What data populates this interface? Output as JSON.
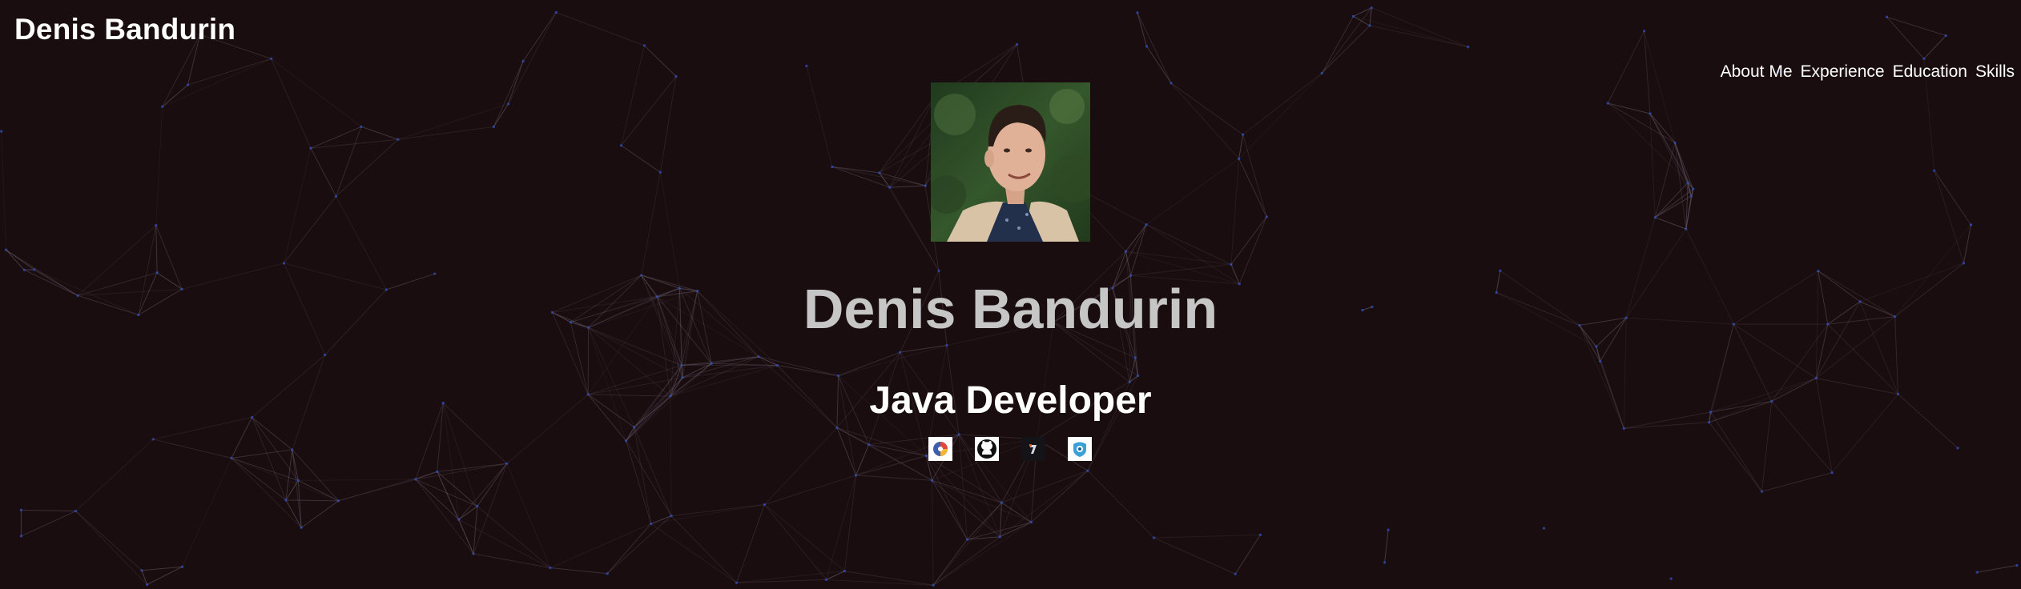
{
  "header": {
    "brand": "Denis Bandurin"
  },
  "nav": {
    "items": [
      {
        "label": "About Me"
      },
      {
        "label": "Experience"
      },
      {
        "label": "Education"
      },
      {
        "label": "Skills"
      }
    ]
  },
  "hero": {
    "name": "Denis Bandurin",
    "role": "Java Developer",
    "avatar_icon": "profile-photo"
  },
  "socials": [
    {
      "icon": "linkedin-like-icon"
    },
    {
      "icon": "github-icon"
    },
    {
      "icon": "codewars-icon"
    },
    {
      "icon": "tryhackme-icon"
    }
  ],
  "colors": {
    "background": "#1a0d10",
    "nav_text": "#ffffff",
    "hero_name": "#c6c6c6",
    "network_line": "#6b6470",
    "network_node": "#2f4fb8"
  }
}
